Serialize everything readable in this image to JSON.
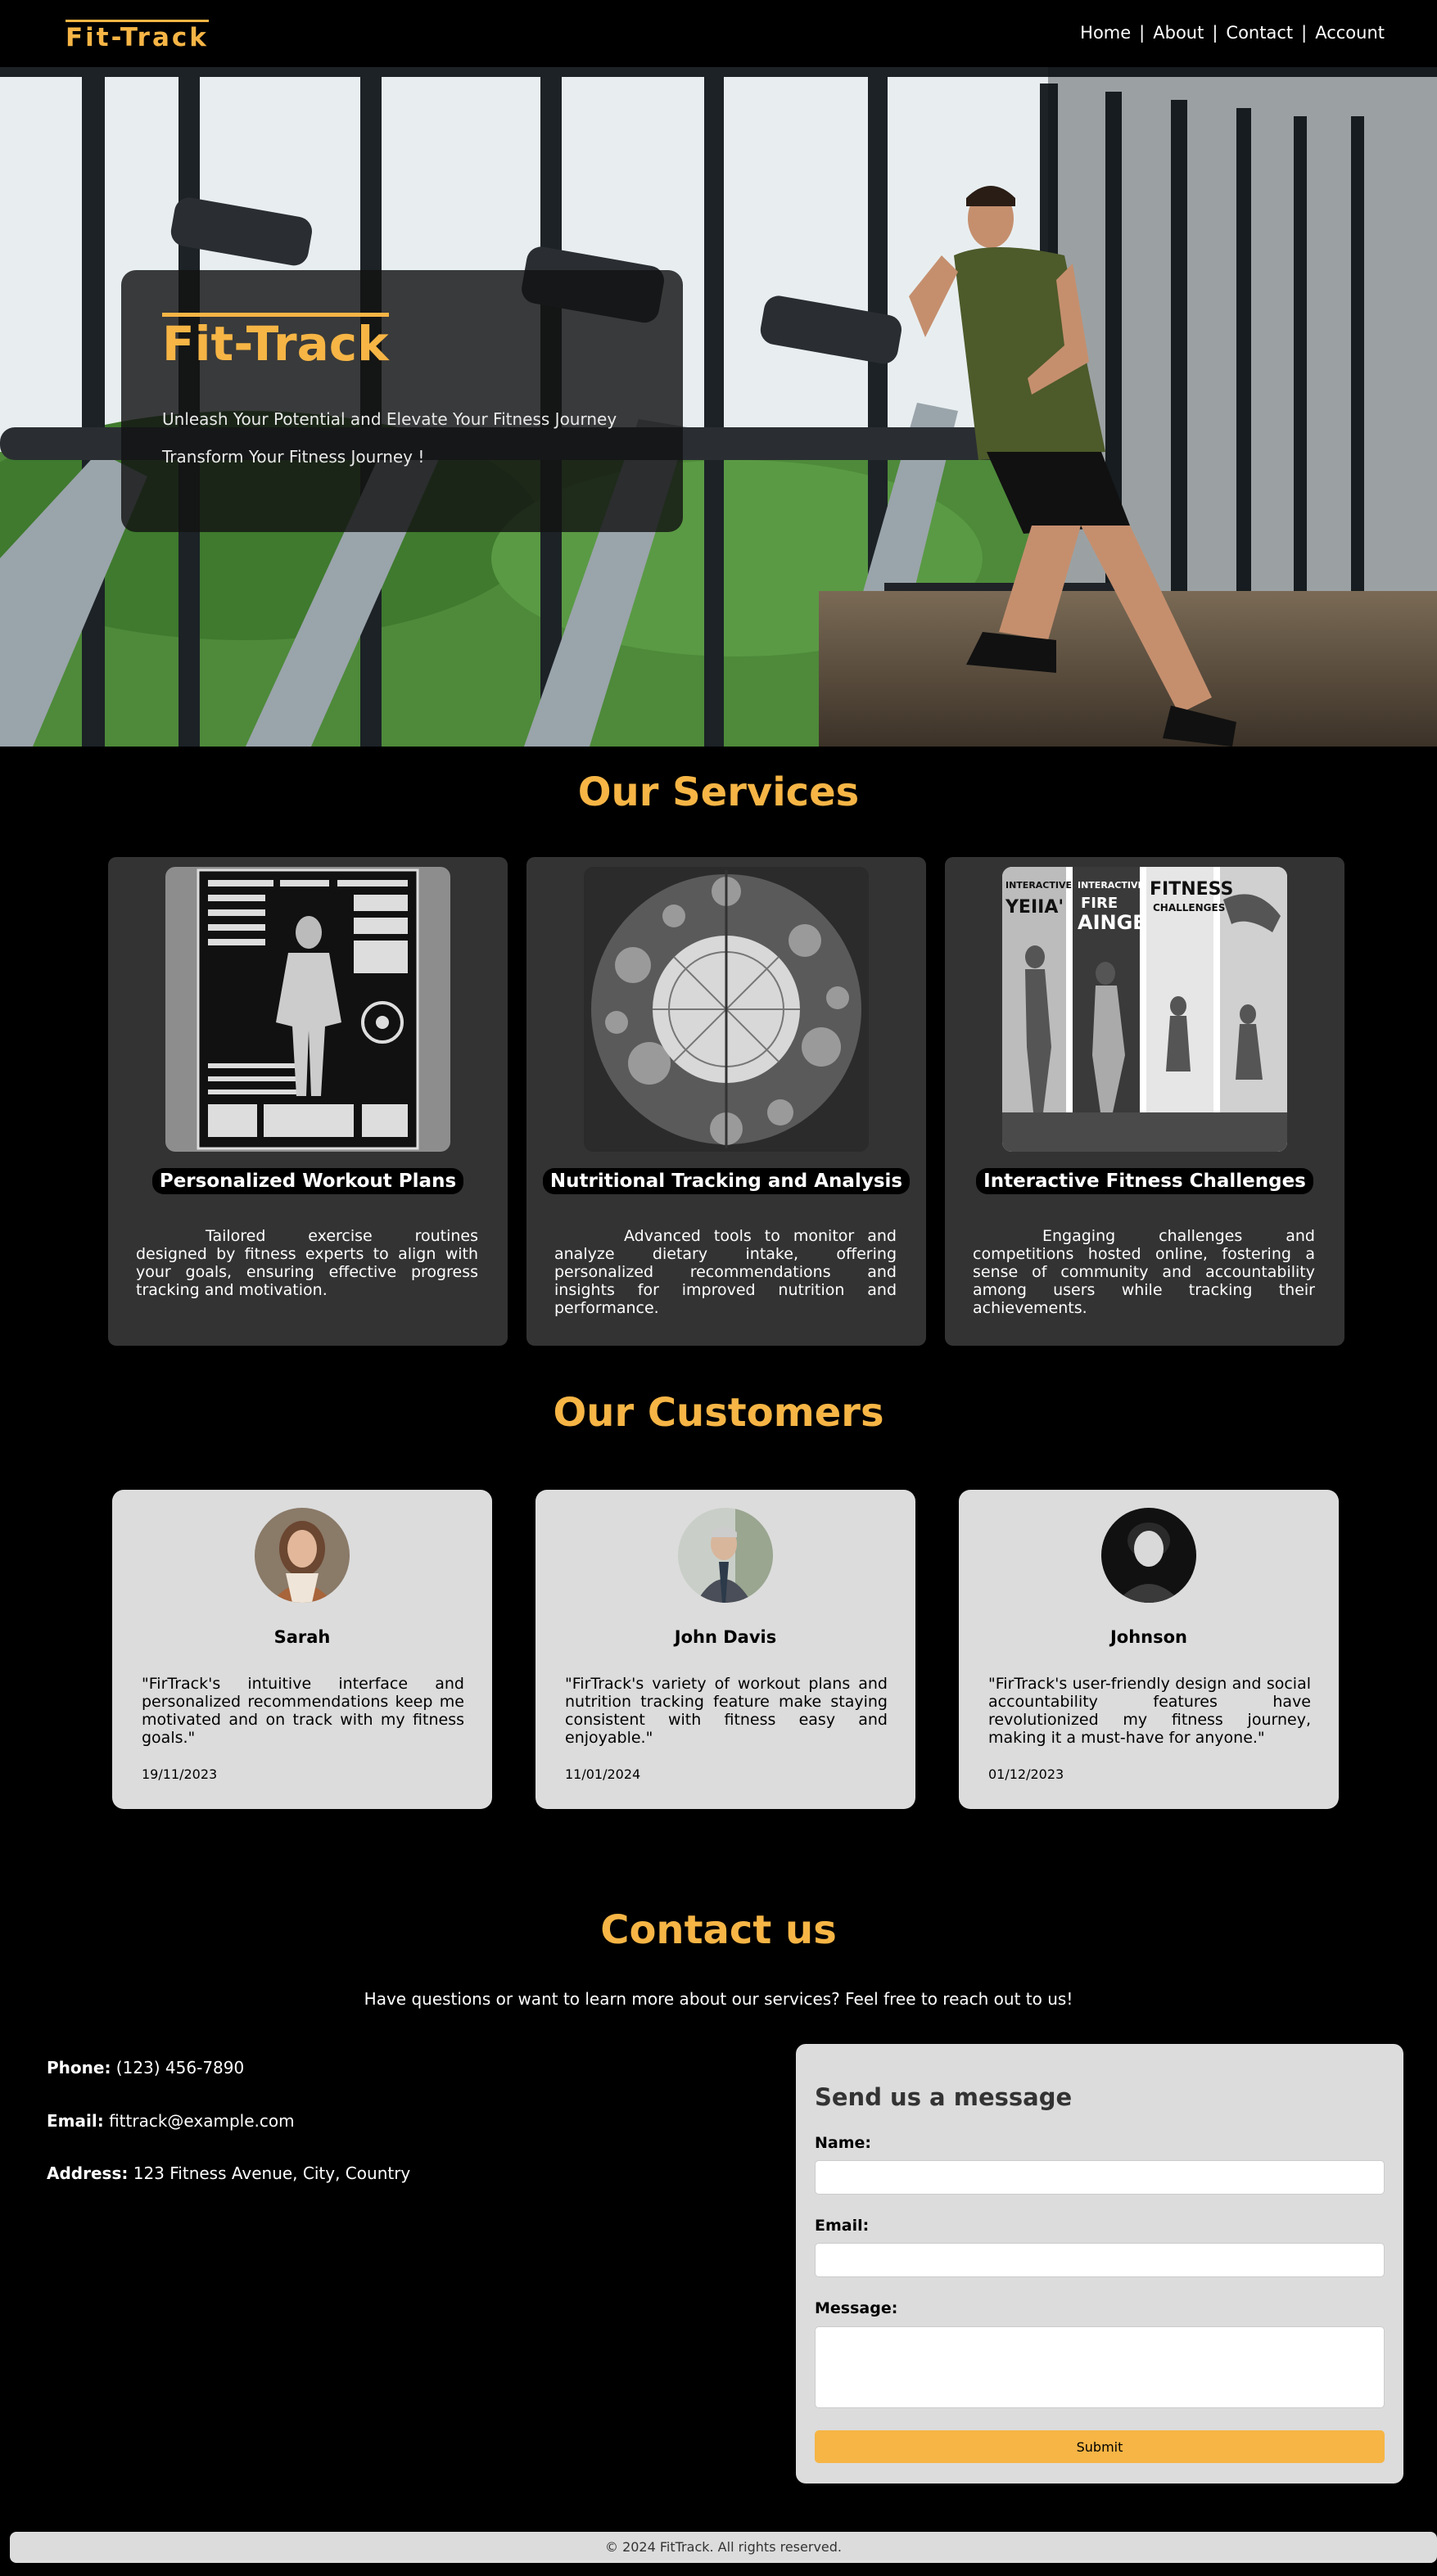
{
  "header": {
    "logo": "Fit-Track",
    "nav": [
      "Home",
      "About",
      "Contact",
      "Account"
    ],
    "separator": "|"
  },
  "hero": {
    "title": "Fit-Track",
    "subtitle1": "Unleash Your Potential and Elevate Your Fitness Journey",
    "subtitle2": "Transform Your Fitness Journey !"
  },
  "services": {
    "title": "Our Services",
    "items": [
      {
        "name": "Personalized Workout Plans",
        "description": "Tailored exercise routines designed by fitness experts to align with your goals, ensuring effective progress tracking and motivation."
      },
      {
        "name": "Nutritional Tracking and Analysis",
        "description": "Advanced tools to monitor and analyze dietary intake, offering personalized recommendations and insights for improved nutrition and performance."
      },
      {
        "name": "Interactive Fitness Challenges",
        "description": "Engaging challenges and competitions hosted online, fostering a sense of community and accountability among users while tracking their achievements."
      }
    ],
    "challenge_banner_texts": [
      "INTERACTIVE",
      "YEIIA'",
      "INTERACTIVE",
      "FIRE",
      "AINGE",
      "FITNESS",
      "CHALLENGES"
    ]
  },
  "customers": {
    "title": "Our Customers",
    "items": [
      {
        "name": "Sarah",
        "quote": "\"FirTrack's intuitive interface and personalized recommendations keep me motivated and on track with my fitness goals.\"",
        "date": "19/11/2023"
      },
      {
        "name": "John Davis",
        "quote": "\"FirTrack's variety of workout plans and nutrition tracking feature make staying consistent with fitness easy and enjoyable.\"",
        "date": "11/01/2024"
      },
      {
        "name": "Johnson",
        "quote": "\"FirTrack's user-friendly design and social accountability features have revolutionized my fitness journey, making it a must-have for anyone.\"",
        "date": "01/12/2023"
      }
    ]
  },
  "contact": {
    "title": "Contact us",
    "intro": "Have questions or want to learn more about our services? Feel free to reach out to us!",
    "phone_label": "Phone:",
    "phone": "(123) 456-7890",
    "email_label": "Email:",
    "email": "fittrack@example.com",
    "address_label": "Address:",
    "address": "123 Fitness Avenue, City, Country",
    "form": {
      "title": "Send us a message",
      "name_label": "Name:",
      "email_label": "Email:",
      "message_label": "Message:",
      "submit": "Submit"
    }
  },
  "footer": {
    "text": "© 2024 FitTrack. All rights reserved."
  },
  "colors": {
    "accent": "#f6b545",
    "card_dark": "#333333",
    "card_light": "#dcdcdc"
  }
}
